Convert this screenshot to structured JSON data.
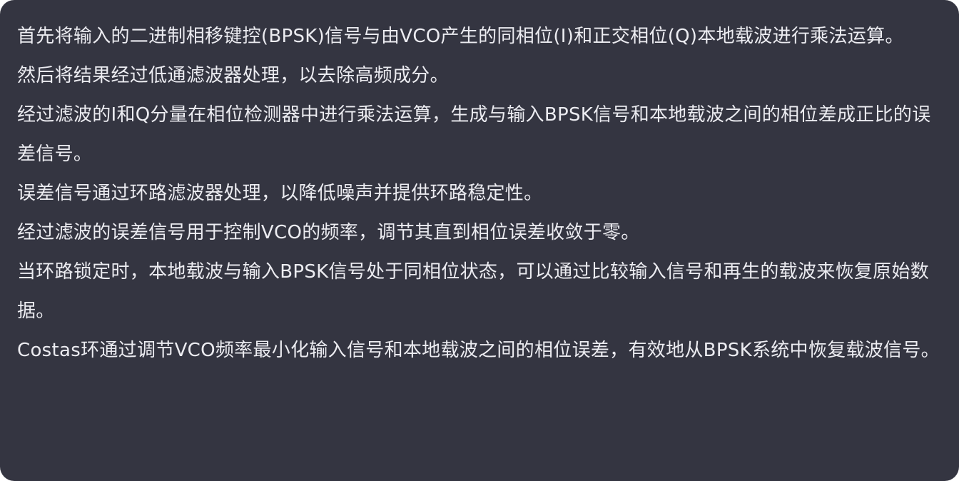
{
  "message": {
    "paragraphs": [
      "首先将输入的二进制相移键控(BPSK)信号与由VCO产生的同相位(I)和正交相位(Q)本地载波进行乘法运算。",
      "然后将结果经过低通滤波器处理，以去除高频成分。",
      "经过滤波的I和Q分量在相位检测器中进行乘法运算，生成与输入BPSK信号和本地载波之间的相位差成正比的误差信号。",
      "误差信号通过环路滤波器处理，以降低噪声并提供环路稳定性。",
      "经过滤波的误差信号用于控制VCO的频率，调节其直到相位误差收敛于零。",
      "当环路锁定时，本地载波与输入BPSK信号处于同相位状态，可以通过比较输入信号和再生的载波来恢复原始数据。",
      "Costas环通过调节VCO频率最小化输入信号和本地载波之间的相位误差，有效地从BPSK系统中恢复载波信号。"
    ]
  },
  "colors": {
    "background": "#343541",
    "text": "#ececf1"
  }
}
